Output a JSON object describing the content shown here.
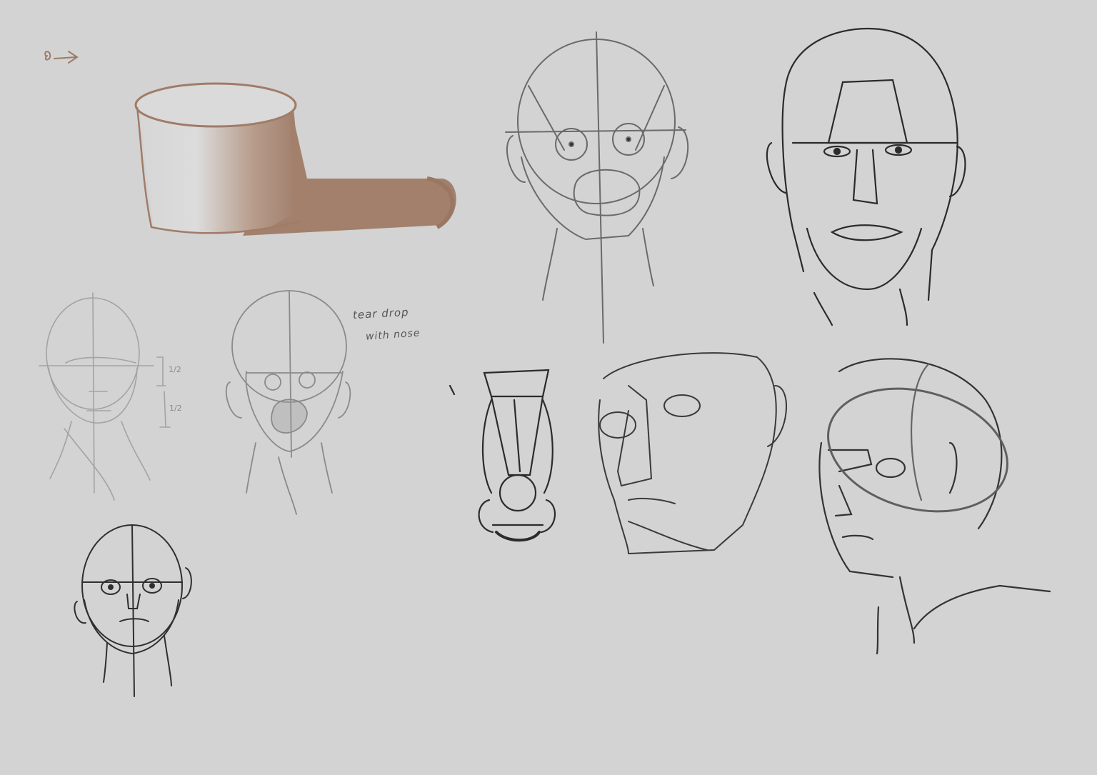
{
  "canvas": {
    "background": "#d3d3d3",
    "stroke_dark": "#2b2b2b",
    "stroke_mid": "#7a7a7a",
    "stroke_light": "#a9a9a9",
    "accent_brown": "#a2806c"
  },
  "annotations": {
    "note_line1": "tear drop",
    "note_line2": "with nose",
    "half_upper": "1/2",
    "half_lower": "1/2"
  },
  "sketches": [
    "shaded-cylinder",
    "loomis-head-light",
    "loomis-head-with-features",
    "loomis-head-dark",
    "planar-head-construction",
    "planar-head-rendered",
    "nose-construction",
    "three-quarter-face",
    "three-quarter-head-with-shoulders"
  ]
}
